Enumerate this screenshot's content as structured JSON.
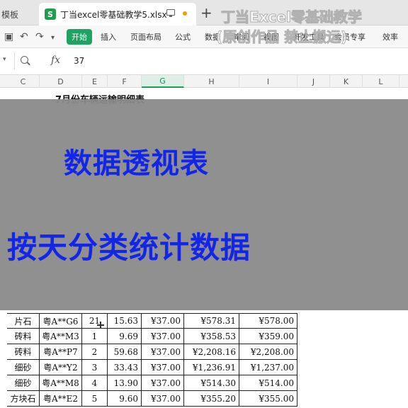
{
  "tabs": {
    "previous_label": "模板",
    "active_title": "丁当excel零基础教学5.xlsx",
    "logo_letter": "S",
    "add_symbol": "+"
  },
  "toolbar": {
    "start_label": "开始",
    "menu": [
      "插入",
      "页面布局",
      "公式",
      "数据",
      "审阅",
      "视图",
      "开发工具",
      "会员专享",
      "效率"
    ]
  },
  "formula_bar": {
    "fx_label": "fx",
    "value": "37"
  },
  "columns": [
    "C",
    "D",
    "E",
    "F",
    "G",
    "H",
    "I",
    "J",
    "K",
    "L"
  ],
  "selected_column": "G",
  "sheet": {
    "title": "7月份车辆运输明细表"
  },
  "rows": [
    {
      "material": "片石",
      "plate": "粤A**G6",
      "day": "21",
      "weight": "15.63",
      "price": "¥37.00",
      "amount": "¥578.31",
      "rounded": "¥578.00"
    },
    {
      "material": "砖料",
      "plate": "粤A**M3",
      "day": "1",
      "weight": "9.69",
      "price": "¥37.00",
      "amount": "¥358.53",
      "rounded": "¥359.00"
    },
    {
      "material": "砖料",
      "plate": "粤A**P7",
      "day": "2",
      "weight": "59.68",
      "price": "¥37.00",
      "amount": "¥2,208.16",
      "rounded": "¥2,208.00"
    },
    {
      "material": "细砂",
      "plate": "粤A**Y2",
      "day": "3",
      "weight": "33.43",
      "price": "¥37.00",
      "amount": "¥1,236.91",
      "rounded": "¥1,237.00"
    },
    {
      "material": "细砂",
      "plate": "粤A**M8",
      "day": "4",
      "weight": "13.90",
      "price": "¥37.00",
      "amount": "¥514.30",
      "rounded": "¥514.00"
    },
    {
      "material": "方块石",
      "plate": "粤A**E2",
      "day": "5",
      "weight": "9.60",
      "price": "¥37.00",
      "amount": "¥355.20",
      "rounded": "¥355.00"
    }
  ],
  "banner": {
    "line1": "数据透视表",
    "line2": "按天分类统计数据"
  },
  "watermark": {
    "line1": "丁当Excel零基础教学",
    "line2": "(原创作品 禁止搬运)"
  },
  "colors": {
    "start_button": "#1fa363",
    "banner_text": "#1326e8",
    "banner_bg": "#8a8a8a",
    "selected_column": "#1e9e5a"
  },
  "icons": [
    "save-icon",
    "undo-icon",
    "redo-icon",
    "dropdown-icon",
    "search-icon",
    "monitor-icon",
    "unsaved-dot-icon"
  ]
}
